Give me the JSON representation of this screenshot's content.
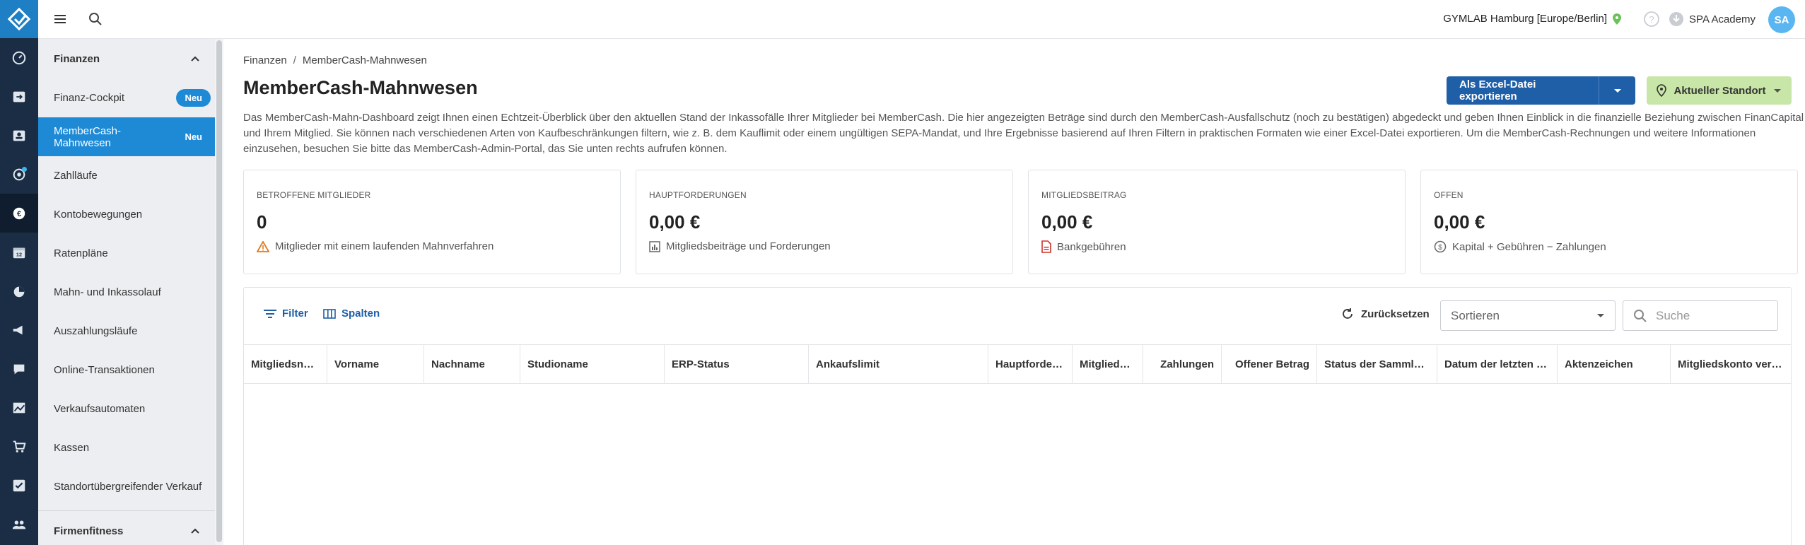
{
  "topbar": {
    "studio": "GYMLAB Hamburg [Europe/Berlin]",
    "academy": "SPA Academy",
    "avatar_initials": "SA"
  },
  "rail": {
    "icons": [
      "dashboard-icon",
      "checkin-icon",
      "members-icon",
      "marketing-icon",
      "finance-icon",
      "calendar-icon",
      "reports-icon",
      "announcements-icon",
      "chat-icon",
      "analytics-icon",
      "shop-icon",
      "tasks-icon",
      "groups-icon"
    ]
  },
  "submenu": {
    "section_finance": "Finanzen",
    "items": [
      {
        "label": "Finanz-Cockpit",
        "badge": "Neu"
      },
      {
        "label": "MemberCash-Mahnwesen",
        "badge": "Neu"
      },
      {
        "label": "Zahlläufe"
      },
      {
        "label": "Kontobewegungen"
      },
      {
        "label": "Ratenpläne"
      },
      {
        "label": "Mahn- und Inkassolauf"
      },
      {
        "label": "Auszahlungsläufe"
      },
      {
        "label": "Online-Transaktionen"
      },
      {
        "label": "Verkaufsautomaten"
      },
      {
        "label": "Kassen"
      },
      {
        "label": "Standortübergreifender Verkauf"
      }
    ],
    "section_corporate": "Firmenfitness"
  },
  "main": {
    "breadcrumb_root": "Finanzen",
    "breadcrumb_current": "MemberCash-Mahnwesen",
    "title": "MemberCash-Mahnwesen",
    "description": "Das MemberCash-Mahn-Dashboard zeigt Ihnen einen Echtzeit-Überblick über den aktuellen Stand der Inkassofälle Ihrer Mitglieder bei MemberCash. Die hier angezeigten Beträge sind durch den MemberCash-Ausfallschutz (noch zu bestätigen) abgedeckt und geben Ihnen Einblick in die finanzielle Beziehung zwischen FinanCapital und Ihrem Mitglied. Sie können nach verschiedenen Arten von Kaufbeschränkungen filtern, wie z. B. dem Kauflimit oder einem ungültigen SEPA-Mandat, und Ihre Ergebnisse basierend auf Ihren Filtern in praktischen Formaten wie einer Excel-Datei exportieren. Um die MemberCash-Rechnungen und weitere Informationen einzusehen, besuchen Sie bitte das MemberCash-Admin-Portal, das Sie unten rechts aufrufen können.",
    "export_label": "Als Excel-Datei exportieren",
    "location_label": "Aktueller Standort"
  },
  "cards": [
    {
      "label": "BETROFFENE MITGLIEDER",
      "value": "0",
      "sub": "Mitglieder mit einem laufenden Mahnverfahren",
      "icon": "warning-icon"
    },
    {
      "label": "HAUPTFORDERUNGEN",
      "value": "0,00 €",
      "sub": "Mitgliedsbeiträge und Forderungen",
      "icon": "chart-icon"
    },
    {
      "label": "MITGLIEDSBEITRAG",
      "value": "0,00 €",
      "sub": "Bankgebühren",
      "icon": "pdf-document-icon"
    },
    {
      "label": "OFFEN",
      "value": "0,00 €",
      "sub": "Kapital + Gebühren − Zahlungen",
      "icon": "coin-icon"
    }
  ],
  "table": {
    "filter_label": "Filter",
    "columns_label": "Spalten",
    "reset_label": "Zurücksetzen",
    "sort_placeholder": "Sortieren",
    "search_placeholder": "Suche",
    "headers": [
      "Mitgliedsnu…",
      "Vorname",
      "Nachname",
      "Studioname",
      "ERP-Status",
      "Ankaufslimit",
      "Hauptforder…",
      "Mitglieds…",
      "Zahlungen",
      "Offener Betrag",
      "Status der Sammlu…",
      "Datum der letzten …",
      "Aktenzeichen",
      "Mitgliedskonto ver…"
    ]
  }
}
